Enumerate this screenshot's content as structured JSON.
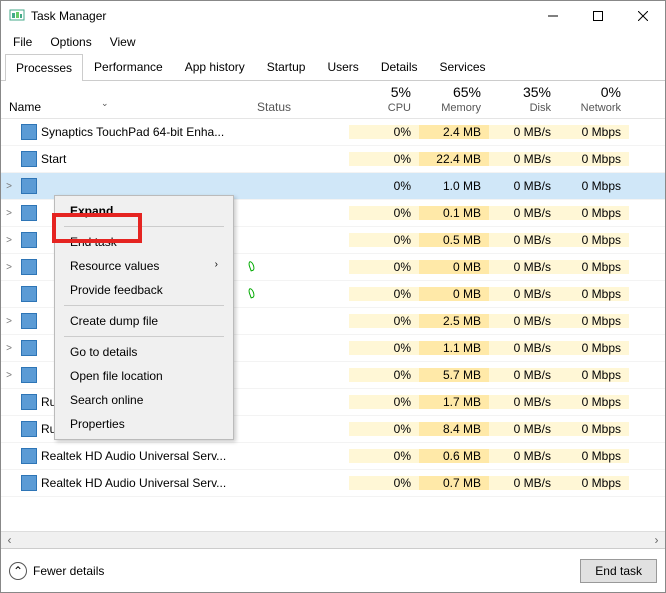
{
  "window": {
    "title": "Task Manager"
  },
  "menu": {
    "file": "File",
    "options": "Options",
    "view": "View"
  },
  "tabs": [
    "Processes",
    "Performance",
    "App history",
    "Startup",
    "Users",
    "Details",
    "Services"
  ],
  "columns": {
    "name": "Name",
    "status": "Status",
    "cpu": {
      "pct": "5%",
      "label": "CPU"
    },
    "memory": {
      "pct": "65%",
      "label": "Memory"
    },
    "disk": {
      "pct": "35%",
      "label": "Disk"
    },
    "network": {
      "pct": "0%",
      "label": "Network"
    }
  },
  "rows": [
    {
      "exp": "",
      "name": "Synaptics TouchPad 64-bit Enha...",
      "cpu": "0%",
      "mem": "2.4 MB",
      "disk": "0 MB/s",
      "net": "0 Mbps"
    },
    {
      "exp": "",
      "name": "Start",
      "cpu": "0%",
      "mem": "22.4 MB",
      "disk": "0 MB/s",
      "net": "0 Mbps"
    },
    {
      "exp": ">",
      "name": "",
      "cpu": "0%",
      "mem": "1.0 MB",
      "disk": "0 MB/s",
      "net": "0 Mbps",
      "selected": true
    },
    {
      "exp": ">",
      "name": "",
      "cpu": "0%",
      "mem": "0.1 MB",
      "disk": "0 MB/s",
      "net": "0 Mbps"
    },
    {
      "exp": ">",
      "name": "",
      "cpu": "0%",
      "mem": "0.5 MB",
      "disk": "0 MB/s",
      "net": "0 Mbps"
    },
    {
      "exp": ">",
      "name": "",
      "cpu": "0%",
      "mem": "0 MB",
      "disk": "0 MB/s",
      "net": "0 Mbps",
      "leaf": true
    },
    {
      "exp": "",
      "name": "",
      "cpu": "0%",
      "mem": "0 MB",
      "disk": "0 MB/s",
      "net": "0 Mbps",
      "leaf": true
    },
    {
      "exp": ">",
      "name": "",
      "cpu": "0%",
      "mem": "2.5 MB",
      "disk": "0 MB/s",
      "net": "0 Mbps"
    },
    {
      "exp": ">",
      "name": "",
      "cpu": "0%",
      "mem": "1.1 MB",
      "disk": "0 MB/s",
      "net": "0 Mbps"
    },
    {
      "exp": ">",
      "name": "",
      "cpu": "0%",
      "mem": "5.7 MB",
      "disk": "0 MB/s",
      "net": "0 Mbps"
    },
    {
      "exp": "",
      "name": "Runtime Broker",
      "cpu": "0%",
      "mem": "1.7 MB",
      "disk": "0 MB/s",
      "net": "0 Mbps"
    },
    {
      "exp": "",
      "name": "Runtime Broker",
      "cpu": "0%",
      "mem": "8.4 MB",
      "disk": "0 MB/s",
      "net": "0 Mbps"
    },
    {
      "exp": "",
      "name": "Realtek HD Audio Universal Serv...",
      "cpu": "0%",
      "mem": "0.6 MB",
      "disk": "0 MB/s",
      "net": "0 Mbps"
    },
    {
      "exp": "",
      "name": "Realtek HD Audio Universal Serv...",
      "cpu": "0%",
      "mem": "0.7 MB",
      "disk": "0 MB/s",
      "net": "0 Mbps"
    }
  ],
  "context_menu": {
    "expand": "Expand",
    "end_task": "End task",
    "resource_values": "Resource values",
    "provide_feedback": "Provide feedback",
    "create_dump": "Create dump file",
    "go_to_details": "Go to details",
    "open_file_location": "Open file location",
    "search_online": "Search online",
    "properties": "Properties"
  },
  "footer": {
    "fewer_details": "Fewer details",
    "end_task": "End task"
  }
}
